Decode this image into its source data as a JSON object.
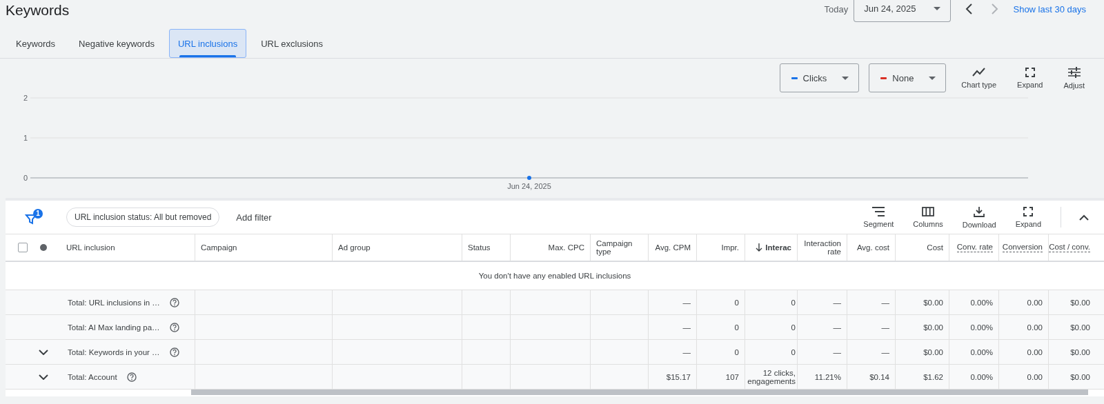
{
  "page_title": "Keywords",
  "date_bar": {
    "label": "Today",
    "date": "Jun 24, 2025",
    "link": "Show last 30 days"
  },
  "tabs": [
    {
      "label": "Keywords",
      "selected": false
    },
    {
      "label": "Negative keywords",
      "selected": false
    },
    {
      "label": "URL inclusions",
      "selected": true
    },
    {
      "label": "URL exclusions",
      "selected": false
    }
  ],
  "metric_selectors": [
    {
      "label": "None",
      "color": "#d93025"
    }
  ],
  "chart_tools": [
    {
      "kind": "chart",
      "label": "Chart type"
    },
    {
      "kind": "expand",
      "label": "Expand"
    },
    {
      "kind": "adjust",
      "label": "Adjust"
    }
  ],
  "chart": {
    "chart_data": {
      "type": "line",
      "categories": [
        "Jun 24, 2025"
      ],
      "series": [
        {
          "name": "Clicks",
          "color": "#1a73e8",
          "marker": true,
          "values": [
            0
          ]
        }
      ],
      "ylim": [
        0,
        2
      ],
      "yticks": [
        0,
        1,
        2
      ]
    }
  },
  "filter_bar": {
    "filter_count": "1",
    "chip": "URL inclusion status: All but removed",
    "add_filter": "Add filter"
  },
  "table_tools": [
    {
      "kind": "segment",
      "label": "Segment"
    },
    {
      "kind": "columns",
      "label": "Columns"
    },
    {
      "kind": "download",
      "label": "Download"
    },
    {
      "kind": "expand",
      "label": "Expand"
    }
  ],
  "table": {
    "select_all": {
      "checked": false
    },
    "columns": [
      {
        "label": "URL inclusion",
        "kind": "text",
        "sorted": false,
        "defined": false
      },
      {
        "label": "Campaign",
        "kind": "text",
        "sorted": false,
        "defined": false
      },
      {
        "label": "Ad group",
        "kind": "text",
        "sorted": false,
        "defined": false
      },
      {
        "label": "Status",
        "kind": "text",
        "sorted": false,
        "defined": false
      },
      {
        "label": "Max. CPC",
        "kind": "number",
        "sorted": false,
        "defined": false
      },
      {
        "label": "Campaign type",
        "kind": "text",
        "sorted": false,
        "defined": false
      },
      {
        "label": "Avg. CPM",
        "kind": "number",
        "sorted": false,
        "defined": false
      },
      {
        "label": "Impr.",
        "kind": "number",
        "sorted": false,
        "defined": false
      },
      {
        "label": "Interac",
        "kind": "number",
        "sorted": true,
        "defined": false
      },
      {
        "label": "Interaction rate",
        "kind": "number",
        "sorted": false,
        "defined": false
      },
      {
        "label": "Avg. cost",
        "kind": "number",
        "sorted": false,
        "defined": false
      },
      {
        "label": "Cost",
        "kind": "number",
        "sorted": false,
        "defined": false
      },
      {
        "label": "Conv. rate",
        "kind": "number",
        "sorted": false,
        "defined": true
      },
      {
        "label": "Conversion",
        "kind": "number",
        "sorted": false,
        "defined": true
      },
      {
        "label": "Cost / conv.",
        "kind": "number",
        "sorted": false,
        "defined": true
      }
    ],
    "empty_message": "You don't have any enabled URL inclusions",
    "rows": [
      {
        "expandable": false,
        "cells": [
          "Total: URL inclusions in …",
          "",
          "",
          "",
          "",
          "",
          "—",
          "0",
          "0",
          "—",
          "—",
          "$0.00",
          "0.00%",
          "0.00",
          "$0.00"
        ]
      },
      {
        "expandable": false,
        "cells": [
          "Total: AI Max landing pa…",
          "",
          "",
          "",
          "",
          "",
          "—",
          "0",
          "0",
          "—",
          "—",
          "$0.00",
          "0.00%",
          "0.00",
          "$0.00"
        ]
      },
      {
        "expandable": true,
        "cells": [
          "Total: Keywords in your …",
          "",
          "",
          "",
          "",
          "",
          "—",
          "0",
          "0",
          "—",
          "—",
          "$0.00",
          "0.00%",
          "0.00",
          "$0.00"
        ]
      },
      {
        "expandable": true,
        "cells": [
          "Total: Account",
          "",
          "",
          "",
          "",
          "",
          "$15.17",
          "107",
          "12 clicks, engagements",
          "11.21%",
          "$0.14",
          "$1.62",
          "0.00%",
          "0.00",
          "$0.00"
        ]
      }
    ]
  }
}
